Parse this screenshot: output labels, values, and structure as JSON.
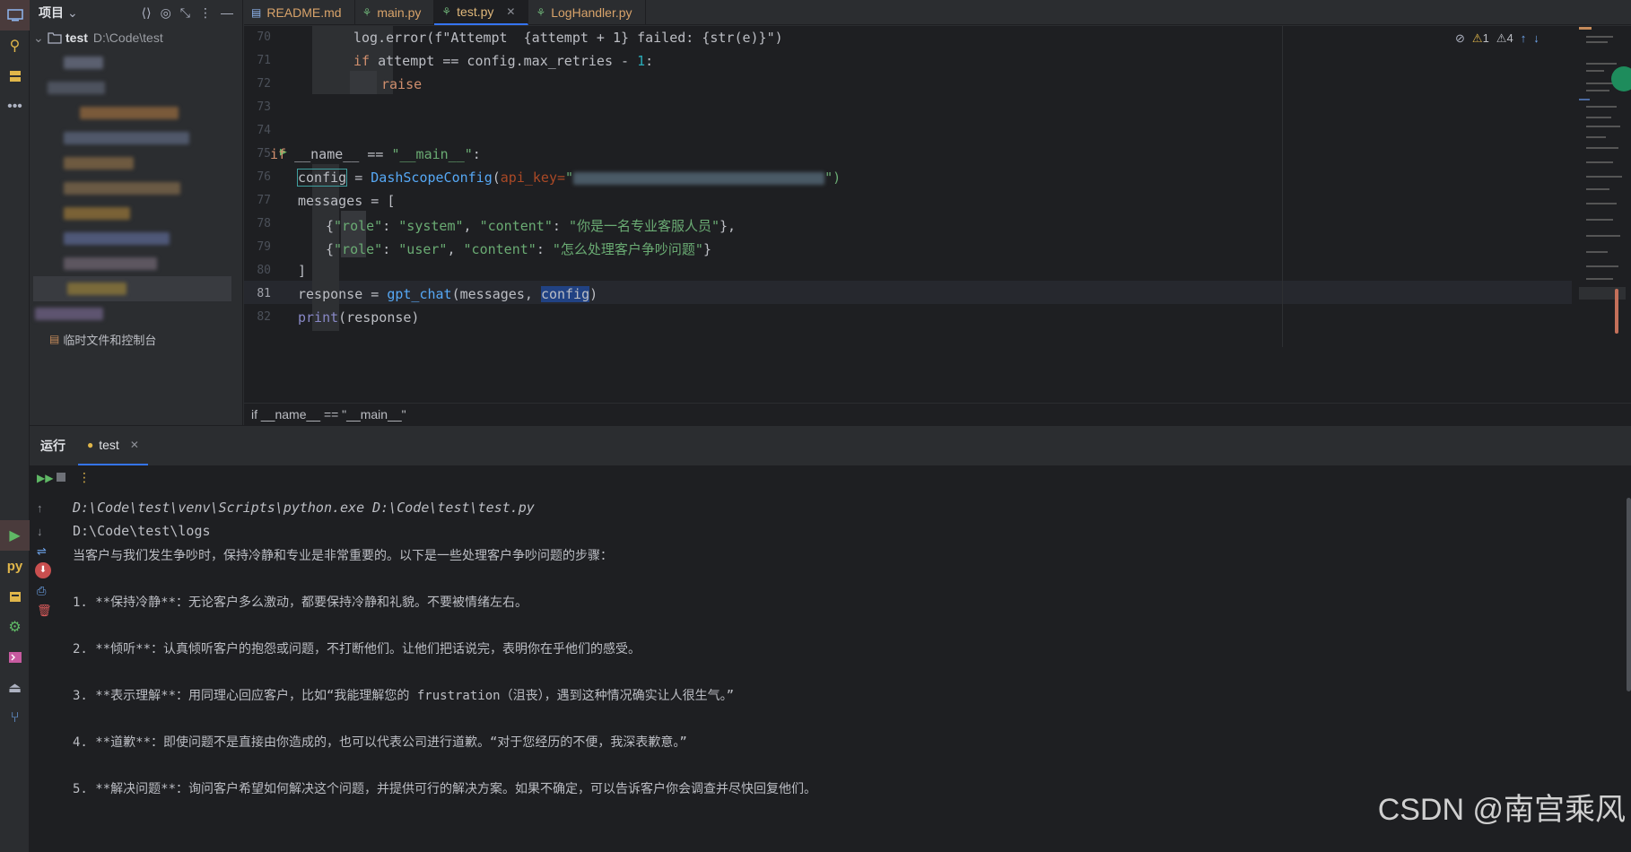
{
  "project_panel": {
    "title": "项目",
    "root_name": "test",
    "root_path": "D:\\Code\\test",
    "scratches_label": "临时文件和控制台"
  },
  "tabs": [
    {
      "label": "README.md",
      "active": false
    },
    {
      "label": "main.py",
      "active": false
    },
    {
      "label": "test.py",
      "active": true
    },
    {
      "label": "LogHandler.py",
      "active": false
    }
  ],
  "editor": {
    "line_numbers": [
      "70",
      "71",
      "72",
      "73",
      "74",
      "75",
      "76",
      "77",
      "78",
      "79",
      "80",
      "81",
      "82"
    ],
    "current_line": "81",
    "inspection": {
      "warn1": "1",
      "warn2": "4"
    },
    "code": {
      "l70": "log.error(f\"Attempt  {attempt + 1} failed: {str(e)}\")",
      "l71_a": "if",
      "l71_b": " attempt == config.max_retries - ",
      "l71_c": "1",
      "l71_d": ":",
      "l72": "raise",
      "l75_a": "if",
      "l75_b": " __name__ == ",
      "l75_c": "\"__main__\"",
      "l75_d": ":",
      "l76_a": "config",
      "l76_b": " = ",
      "l76_c": "DashScopeConfig",
      "l76_d": "(",
      "l76_e": "api_key=",
      "l76_f": "\"",
      "l76_g": "\")",
      "l77": "messages = [",
      "l78_a": "{",
      "l78_b": "\"role\"",
      "l78_c": ": ",
      "l78_d": "\"system\"",
      "l78_e": ", ",
      "l78_f": "\"content\"",
      "l78_g": ": ",
      "l78_h": "\"你是一名专业客服人员\"",
      "l78_i": "},",
      "l79_a": "{",
      "l79_b": "\"role\"",
      "l79_c": ": ",
      "l79_d": "\"user\"",
      "l79_e": ", ",
      "l79_f": "\"content\"",
      "l79_g": ": ",
      "l79_h": "\"怎么处理客户争吵问题\"",
      "l79_i": "}",
      "l80": "]",
      "l81_a": "response = ",
      "l81_b": "gpt_chat",
      "l81_c": "(messages, ",
      "l81_d": "config",
      "l81_e": ")",
      "l82_a": "print",
      "l82_b": "(response)"
    },
    "breadcrumb": "if __name__ == \"__main__\""
  },
  "run_panel": {
    "title": "运行",
    "tab_label": "test",
    "output": [
      "D:\\Code\\test\\venv\\Scripts\\python.exe D:\\Code\\test\\test.py",
      "D:\\Code\\test\\logs",
      "当客户与我们发生争吵时，保持冷静和专业是非常重要的。以下是一些处理客户争吵问题的步骤：",
      "",
      "1. **保持冷静**：无论客户多么激动，都要保持冷静和礼貌。不要被情绪左右。",
      "",
      "2. **倾听**：认真倾听客户的抱怨或问题，不打断他们。让他们把话说完，表明你在乎他们的感受。",
      "",
      "3. **表示理解**：用同理心回应客户，比如“我能理解您的 frustration（沮丧），遇到这种情况确实让人很生气。”",
      "",
      "4. **道歉**：即使问题不是直接由你造成的，也可以代表公司进行道歉。“对于您经历的不便，我深表歉意。”",
      "",
      "5. **解决问题**：询问客户希望如何解决这个问题，并提供可行的解决方案。如果不确定，可以告诉客户你会调查并尽快回复他们。"
    ]
  },
  "watermark": "CSDN @南宫乘风",
  "colors": {
    "accent": "#3574f0",
    "keyword": "#cf8e6d",
    "string": "#6aab73",
    "function": "#56a8f5",
    "number": "#2aacb8"
  }
}
